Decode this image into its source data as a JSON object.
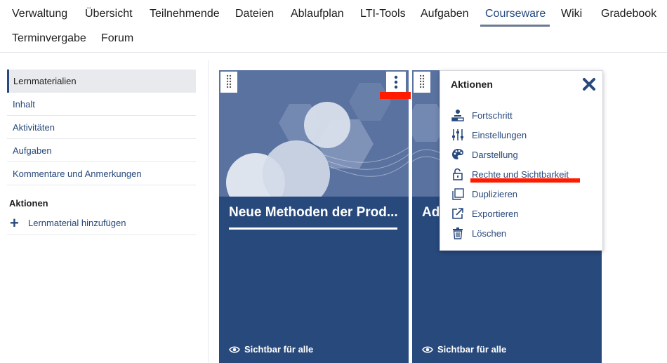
{
  "nav": {
    "items": [
      "Verwaltung",
      "Übersicht",
      "Teilnehmende",
      "Dateien",
      "Ablaufplan",
      "LTI-Tools",
      "Aufgaben",
      "Courseware",
      "Wiki",
      "Gradebook",
      "Terminvergabe",
      "Forum"
    ],
    "active": "Courseware"
  },
  "sidebar": {
    "items": [
      "Lernmaterialien",
      "Inhalt",
      "Aktivitäten",
      "Aufgaben",
      "Kommentare und Anmerkungen"
    ],
    "actions_heading": "Aktionen",
    "add_label": "Lernmaterial hinzufügen"
  },
  "cards": [
    {
      "title": "Neue Methoden der Prod...",
      "visibility": "Sichtbar für alle"
    },
    {
      "title": "Ad",
      "visibility": "Sichtbar für alle"
    }
  ],
  "popup": {
    "title": "Aktionen",
    "items": [
      "Fortschritt",
      "Einstellungen",
      "Darstellung",
      "Rechte und Sichtbarkeit",
      "Duplizieren",
      "Exportieren",
      "Löschen"
    ]
  },
  "colors": {
    "brand": "#28497c",
    "annotation": "#ff1a00"
  }
}
